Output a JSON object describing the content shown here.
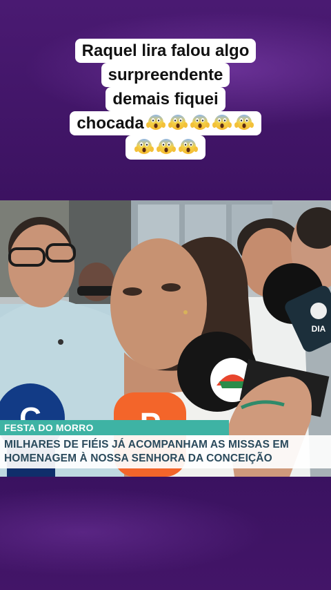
{
  "caption": {
    "lines": [
      "Raquel lira falou algo",
      "surpreendente",
      "demais fiquei",
      "chocada"
    ],
    "emoji_row1_count": 5,
    "emoji_row2_count": 3,
    "emoji_icon": "face-screaming-in-fear-emoji"
  },
  "news": {
    "label": "FESTA DO MORRO",
    "headline_line1": "MILHARES DE FIÉIS JÁ ACOMPANHAM AS MISSAS EM",
    "headline_line2": "HOMENAGEM À NOSSA SENHORA DA CONCEIÇÃO"
  },
  "mics": {
    "right_mic_text": "DIA",
    "left_mic_letter": "C",
    "orange_mic_letter": "P"
  },
  "colors": {
    "background": "#3b1260",
    "label_bar": "#3eb3a4",
    "headline_text": "#2a4a5c",
    "headline_bg": "#ffffff"
  }
}
